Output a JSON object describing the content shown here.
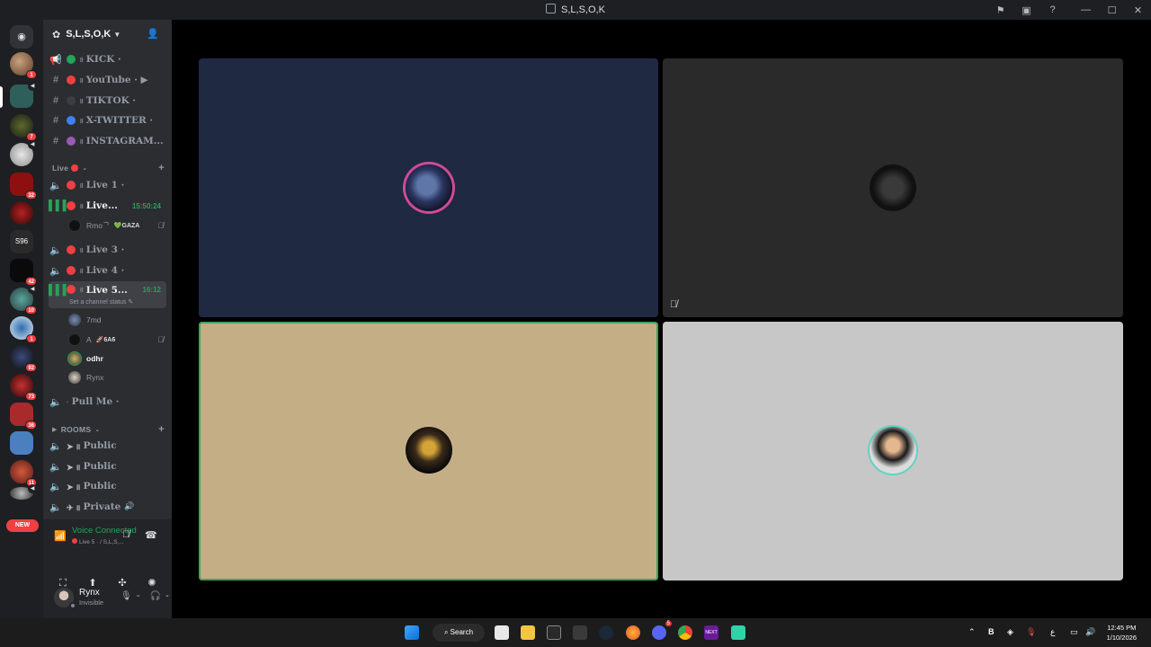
{
  "window": {
    "title": "S,L,S,O,K"
  },
  "server": {
    "name": "S,L,S,O,K"
  },
  "text_channels": [
    {
      "name": "KICK",
      "suffix": "·",
      "dot": "#23a55a"
    },
    {
      "name": "YouTube",
      "suffix": "· ▶",
      "dot": "#f23f43"
    },
    {
      "name": "TIKTOK",
      "suffix": "·",
      "dot": "#3b3d44"
    },
    {
      "name": "X-TWITTER",
      "suffix": "·",
      "dot": "#3b82f6"
    },
    {
      "name": "INSTAGRAM...",
      "suffix": "",
      "dot": "#9b59b6"
    }
  ],
  "live_category": {
    "label": "Live"
  },
  "live_channels": [
    {
      "name": "Live 1",
      "suffix": "·"
    },
    {
      "name": "Live...",
      "time": "15:50:24"
    },
    {
      "name": "Live 3",
      "suffix": "·"
    },
    {
      "name": "Live 4",
      "suffix": "·"
    },
    {
      "name": "Live 5...",
      "time": "16:12"
    }
  ],
  "live2_user": {
    "name": "Rmoᄀ",
    "tag": "💚GAZA"
  },
  "live5_status": "Set a channel status",
  "live5_users": [
    {
      "name": "7md"
    },
    {
      "name": "A",
      "tag": "🚀6A6"
    },
    {
      "name": "odhr"
    },
    {
      "name": "Rynx"
    }
  ],
  "pull_me": {
    "name": "Pull Me",
    "suffix": "·"
  },
  "rooms_category": {
    "label": "ROOMS"
  },
  "rooms_channels": [
    {
      "name": "Public"
    },
    {
      "name": "Public"
    },
    {
      "name": "Public"
    },
    {
      "name": "Private"
    }
  ],
  "guild_badges": [
    "1",
    "7",
    "32",
    "42",
    "10",
    "1",
    "92",
    "73",
    "36",
    "11"
  ],
  "new_badge": "NEW",
  "voice": {
    "status": "Voice Connected",
    "channel": "Live 5 · / S,L,S,..."
  },
  "user": {
    "name": "Rynx",
    "status": "Invisible"
  },
  "taskbar": {
    "search_label": "Search",
    "time": "12:45 PM",
    "date": "1/10/2026",
    "next_label": "NEXT",
    "notif_count": "5"
  },
  "colors": {
    "tile_1": "#1f2942",
    "tile_2": "#2a2a2a",
    "tile_3": "#c4ae86",
    "tile_4": "#c7c7c7",
    "speaking_outline": "#3ba55d"
  }
}
